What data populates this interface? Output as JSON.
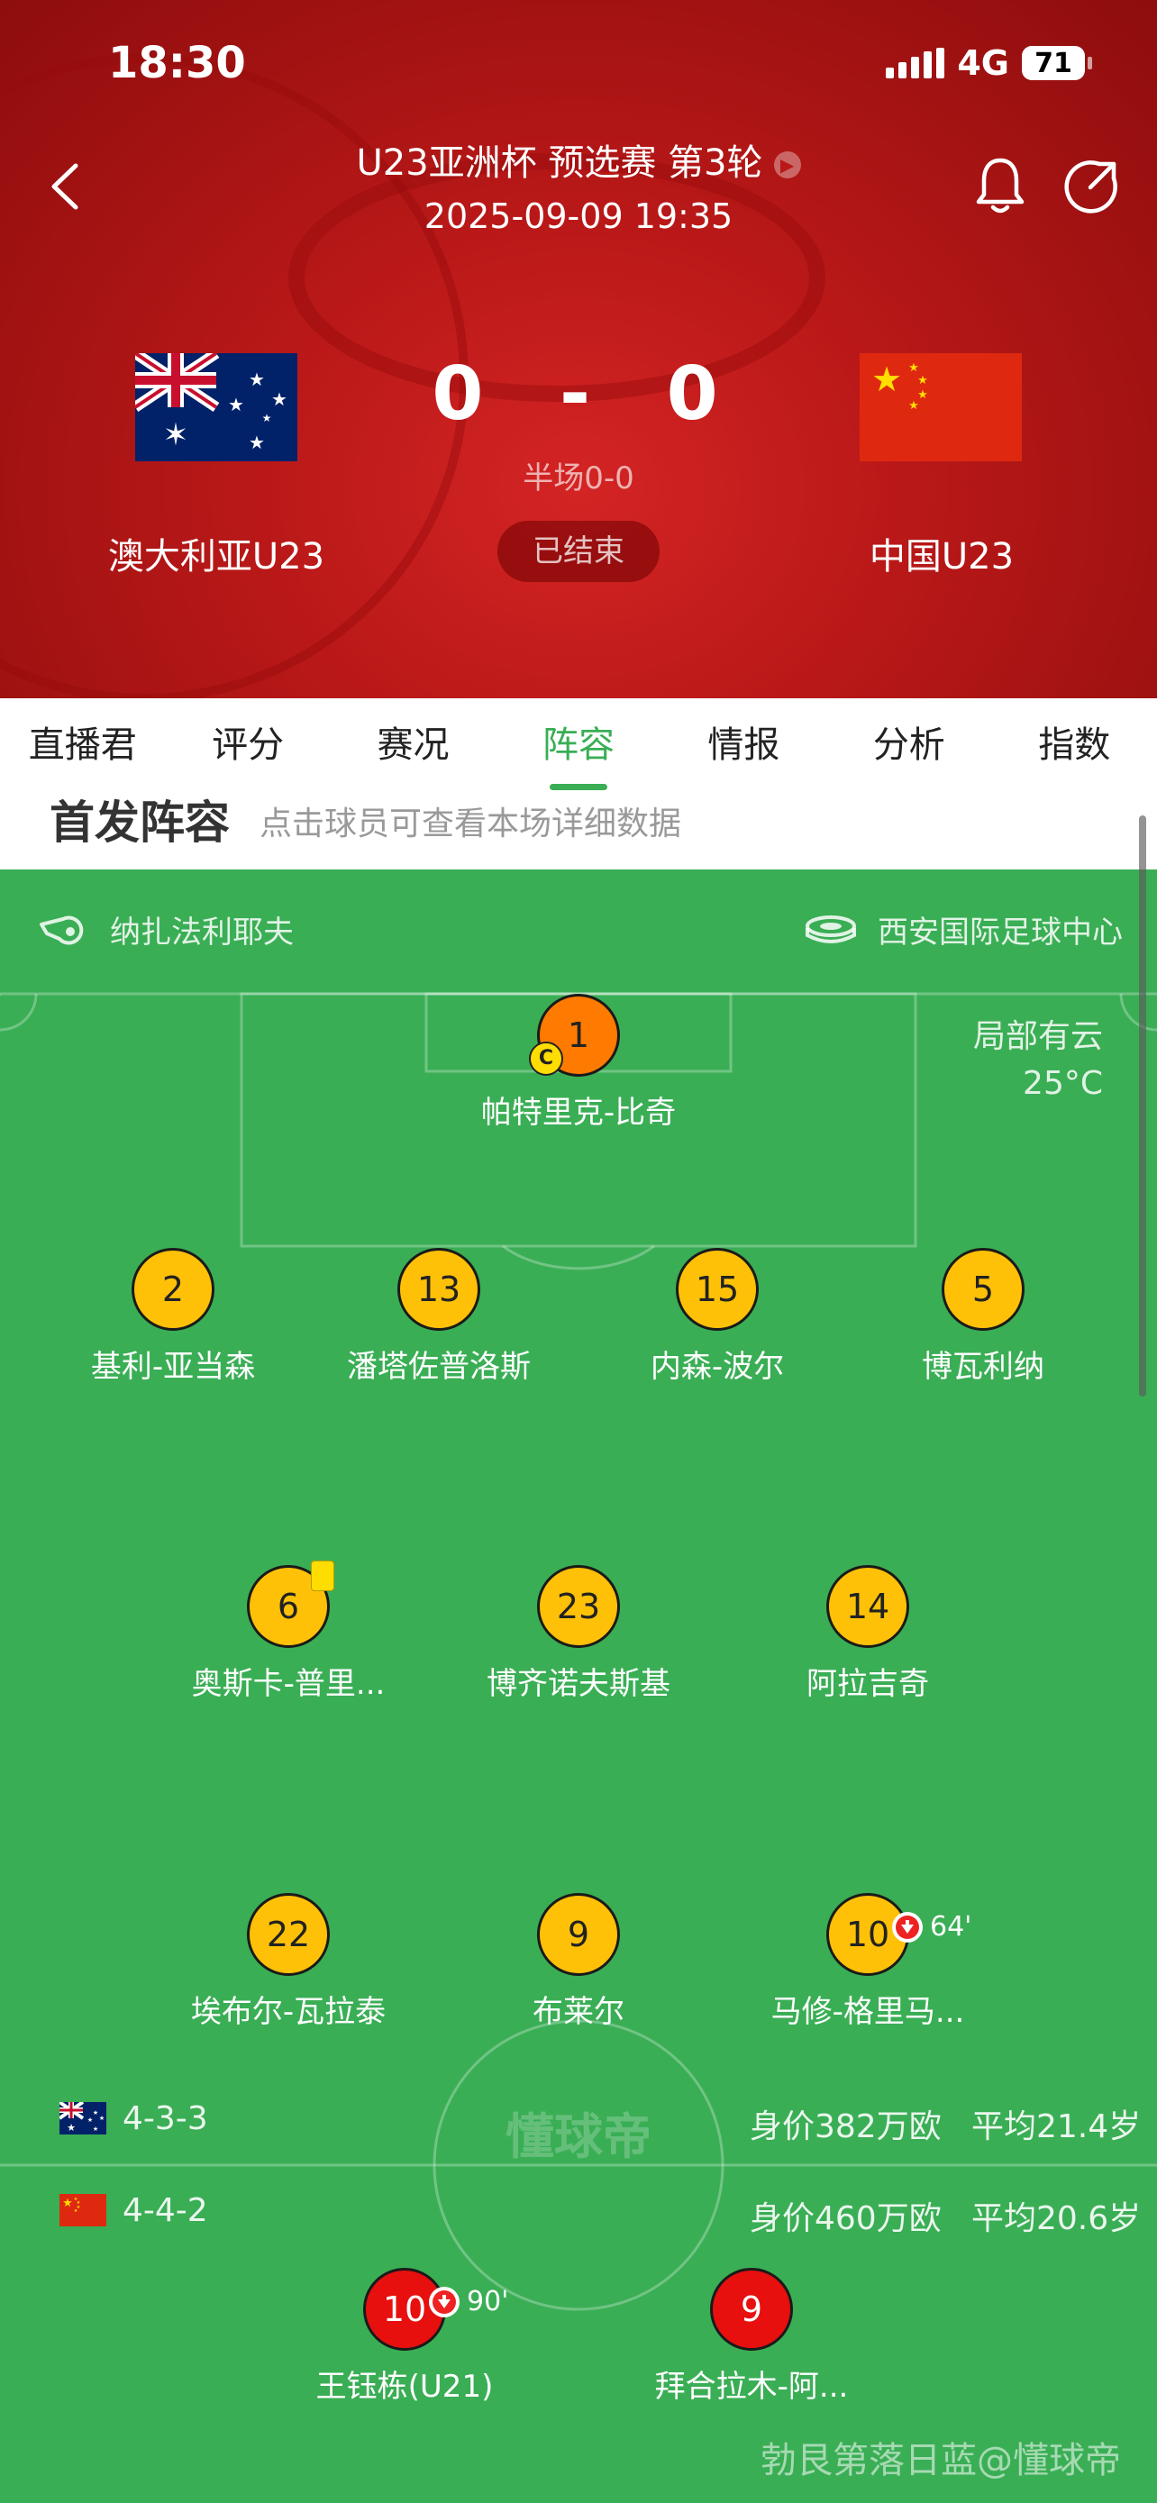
{
  "status_bar": {
    "time": "18:30",
    "network": "4G",
    "battery": "71"
  },
  "header": {
    "title": "U23亚洲杯 预选赛 第3轮",
    "datetime": "2025-09-09 19:35",
    "home_team": "澳大利亚U23",
    "away_team": "中国U23",
    "home_score": "0",
    "separator": "-",
    "away_score": "0",
    "halftime": "半场0-0",
    "status": "已结束",
    "icons": [
      "back-icon",
      "bell-icon",
      "share-icon",
      "chevron-right-icon"
    ]
  },
  "tabs": [
    "直播君",
    "评分",
    "赛况",
    "阵容",
    "情报",
    "分析",
    "指数"
  ],
  "active_tab": "阵容",
  "lineup": {
    "section_title": "首发阵容",
    "section_hint": "点击球员可查看本场详细数据",
    "referee": "纳扎法利耶夫",
    "stadium": "西安国际足球中心",
    "weather": "局部有云",
    "temperature": "25°C",
    "home": {
      "formation": "4-3-3",
      "market_value": "身价382万欧",
      "avg_age": "平均21.4岁",
      "players": [
        {
          "number": "1",
          "name": "帕特里克-比奇",
          "captain": "C"
        },
        {
          "number": "2",
          "name": "基利-亚当森"
        },
        {
          "number": "13",
          "name": "潘塔佐普洛斯"
        },
        {
          "number": "15",
          "name": "内森-波尔"
        },
        {
          "number": "5",
          "name": "博瓦利纳"
        },
        {
          "number": "6",
          "name": "奥斯卡-普里...",
          "yellow_card": true
        },
        {
          "number": "23",
          "name": "博齐诺夫斯基"
        },
        {
          "number": "14",
          "name": "阿拉吉奇"
        },
        {
          "number": "22",
          "name": "埃布尔-瓦拉泰"
        },
        {
          "number": "9",
          "name": "布莱尔"
        },
        {
          "number": "10",
          "name": "马修-格里马...",
          "sub_minute": "64'"
        }
      ]
    },
    "away": {
      "formation": "4-4-2",
      "market_value": "身价460万欧",
      "avg_age": "平均20.6岁",
      "players": [
        {
          "number": "10",
          "name": "王钰栋(U21)",
          "sub_minute": "90'"
        },
        {
          "number": "9",
          "name": "拜合拉木-阿..."
        }
      ]
    },
    "center_logo": "懂球帝",
    "watermark": "勃艮第落日蓝@懂球帝"
  },
  "colors": {
    "accent": "#3aae55",
    "header_red": "#b91818",
    "player_yellow": "#ffc107",
    "goalkeeper": "#ff7a00",
    "china_red": "#e80f0f"
  }
}
